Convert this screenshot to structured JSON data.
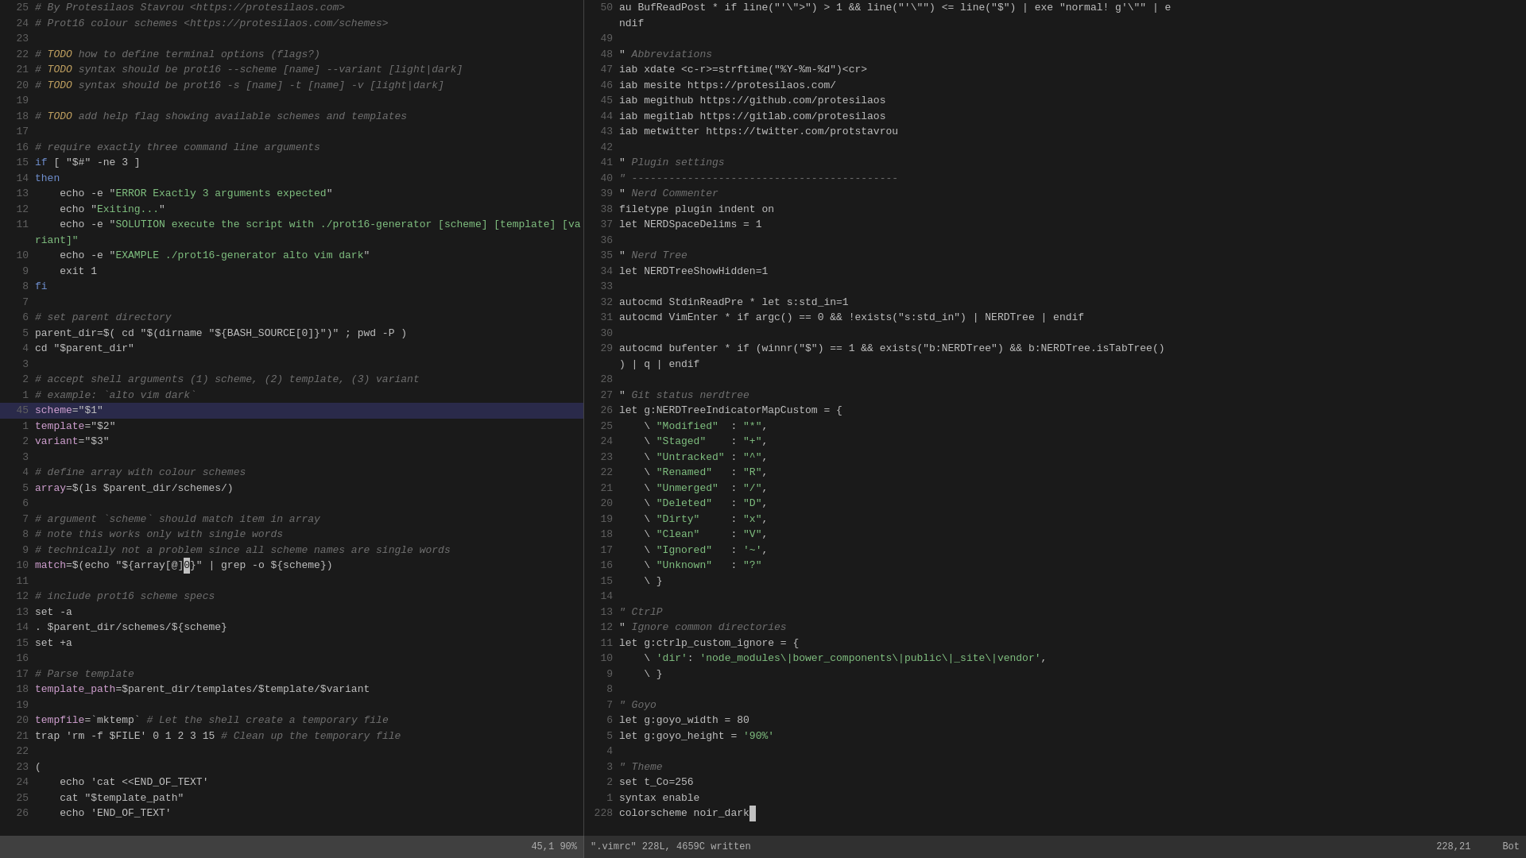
{
  "left_pane": {
    "lines": [
      {
        "num": "25",
        "content": "<comment># By Protesilaos Stavrou <https://protesilaos.com></comment>"
      },
      {
        "num": "24",
        "content": "<comment># Prot16 colour schemes <https://protesilaos.com/schemes></comment>"
      },
      {
        "num": "23",
        "content": ""
      },
      {
        "num": "22",
        "content": "<comment># <todo>TODO</todo> how to define terminal options (flags?)</comment>"
      },
      {
        "num": "21",
        "content": "<comment># <todo>TODO</todo> syntax should be prot16 --scheme [name] --variant [light|dark]</comment>"
      },
      {
        "num": "20",
        "content": "<comment># <todo>TODO</todo> syntax should be prot16 -s [name] -t [name] -v [light|dark]</comment>"
      },
      {
        "num": "19",
        "content": ""
      },
      {
        "num": "18",
        "content": "<comment># <todo>TODO</todo> add help flag showing available schemes and templates</comment>"
      },
      {
        "num": "17",
        "content": ""
      },
      {
        "num": "16",
        "content": "<comment># require exactly three command line arguments</comment>"
      },
      {
        "num": "15",
        "content": "<kw>if</kw> [ \"$#\" -ne 3 ]"
      },
      {
        "num": "14",
        "content": "<kw>then</kw>"
      },
      {
        "num": "13",
        "content": "    echo -e \"<str>ERROR Exactly 3 arguments expected</str>\""
      },
      {
        "num": "12",
        "content": "    echo \"<str>Exiting...</str>\""
      },
      {
        "num": "11",
        "content": "    echo -e \"<str>SOLUTION execute the script with ./prot16-generator [scheme] [template] [va</str>"
      },
      {
        "num": "",
        "content": "<str>riant]\"</str>"
      },
      {
        "num": "10",
        "content": "    echo -e \"<str>EXAMPLE ./prot16-generator alto vim dark</str>\""
      },
      {
        "num": "9",
        "content": "    exit 1"
      },
      {
        "num": "8",
        "content": "<kw>fi</kw>"
      },
      {
        "num": "7",
        "content": ""
      },
      {
        "num": "6",
        "content": "<comment># set parent directory</comment>"
      },
      {
        "num": "5",
        "content": "parent_dir=$( cd \"$(dirname \"${BASH_SOURCE[0]}\")\" ; pwd -P )"
      },
      {
        "num": "4",
        "content": "cd \"$parent_dir\""
      },
      {
        "num": "3",
        "content": ""
      },
      {
        "num": "2",
        "content": "<comment># accept shell arguments (1) scheme, (2) template, (3) variant</comment>"
      },
      {
        "num": "1",
        "content": "<comment># example: `alto vim dark`</comment>"
      },
      {
        "num": "45",
        "highlight": true,
        "content": "<var>scheme</var>=\"$1\""
      },
      {
        "num": "1",
        "content": "<var>template</var>=\"$2\""
      },
      {
        "num": "2",
        "content": "<var>variant</var>=\"$3\""
      },
      {
        "num": "3",
        "content": ""
      },
      {
        "num": "4",
        "content": "<comment># define array with colour schemes</comment>"
      },
      {
        "num": "5",
        "content": "<var>array</var>=$(ls $parent_dir/schemes/)"
      },
      {
        "num": "6",
        "content": ""
      },
      {
        "num": "7",
        "content": "<comment># argument `scheme` should match item in array</comment>"
      },
      {
        "num": "8",
        "content": "<comment># note this works only with single words</comment>"
      },
      {
        "num": "9",
        "content": "<comment># technically not a problem since all scheme names are single words</comment>"
      },
      {
        "num": "10",
        "content": "<var>match</var>=$(echo \"${array[@]<cursor>0</cursor>}\" | grep -o ${scheme})"
      },
      {
        "num": "11",
        "content": ""
      },
      {
        "num": "12",
        "content": "<comment># include prot16 scheme specs</comment>"
      },
      {
        "num": "13",
        "content": "set -a"
      },
      {
        "num": "14",
        "content": ". $parent_dir/schemes/${scheme}"
      },
      {
        "num": "15",
        "content": "set +a"
      },
      {
        "num": "16",
        "content": ""
      },
      {
        "num": "17",
        "content": "<comment># Parse template</comment>"
      },
      {
        "num": "18",
        "content": "<var>template_path</var>=$parent_dir/templates/$template/$variant"
      },
      {
        "num": "19",
        "content": ""
      },
      {
        "num": "20",
        "content": "<var>tempfile</var>=`mktemp` <comment># Let the shell create a temporary file</comment>"
      },
      {
        "num": "21",
        "content": "trap 'rm -f $FILE' 0 1 2 3 15 <comment># Clean up the temporary file</comment>"
      },
      {
        "num": "22",
        "content": ""
      },
      {
        "num": "23",
        "content": "("
      },
      {
        "num": "24",
        "content": "    echo 'cat <<END_OF_TEXT'"
      },
      {
        "num": "25",
        "content": "    cat \"$template_path\""
      },
      {
        "num": "26",
        "content": "    echo 'END_OF_TEXT'"
      }
    ],
    "status": "45,1          90%"
  },
  "right_pane": {
    "lines": [
      {
        "num": "50",
        "content": "au BufReadPost * if line(\"'\\\">\") > 1 && line(\"'\\\"\") <= line(\"$\") | exe \"normal! g'\\\"\" | e"
      },
      {
        "num": "",
        "content": "ndif"
      },
      {
        "num": "49",
        "content": ""
      },
      {
        "num": "48",
        "content": "\" <italic>Abbreviations</italic>"
      },
      {
        "num": "47",
        "content": "iab xdate <c-r>=strftime(\"%Y-%m-%d\")<cr>"
      },
      {
        "num": "46",
        "content": "iab mesite https://protesilaos.com/"
      },
      {
        "num": "45",
        "content": "iab megithub https://github.com/protesilaos"
      },
      {
        "num": "44",
        "content": "iab megitlab https://gitlab.com/protesilaos"
      },
      {
        "num": "43",
        "content": "iab metwitter https://twitter.com/protstavrou"
      },
      {
        "num": "42",
        "content": ""
      },
      {
        "num": "41",
        "content": "\" <italic>Plugin settings</italic>"
      },
      {
        "num": "40",
        "content": "\" -------------------------------------------"
      },
      {
        "num": "39",
        "content": "\" <italic>Nerd Commenter</italic>"
      },
      {
        "num": "38",
        "content": "filetype plugin indent on"
      },
      {
        "num": "37",
        "content": "let NERDSpaceDelims = 1"
      },
      {
        "num": "36",
        "content": ""
      },
      {
        "num": "35",
        "content": "\" <italic>Nerd Tree</italic>"
      },
      {
        "num": "34",
        "content": "let NERDTreeShowHidden=1"
      },
      {
        "num": "33",
        "content": ""
      },
      {
        "num": "32",
        "content": "autocmd StdinReadPre * let s:std_in=1"
      },
      {
        "num": "31",
        "content": "autocmd VimEnter * if argc() == 0 && !exists(\"s:std_in\") | NERDTree | endif"
      },
      {
        "num": "30",
        "content": ""
      },
      {
        "num": "29",
        "content": "autocmd bufenter * if (winnr(\"$\") == 1 && exists(\"b:NERDTree\") && b:NERDTree.isTabTree()"
      },
      {
        "num": "",
        "content": ") | q | endif"
      },
      {
        "num": "28",
        "content": ""
      },
      {
        "num": "27",
        "content": "\" <italic>Git status nerdtree</italic>"
      },
      {
        "num": "26",
        "content": "let g:NERDTreeIndicatorMapCustom = {"
      },
      {
        "num": "25",
        "content": "    \\ \"Modified\"  : \"*\","
      },
      {
        "num": "24",
        "content": "    \\ \"Staged\"    : \"+\","
      },
      {
        "num": "23",
        "content": "    \\ \"Untracked\" : \"^\","
      },
      {
        "num": "22",
        "content": "    \\ \"Renamed\"   : \"R\","
      },
      {
        "num": "21",
        "content": "    \\ \"Unmerged\"  : \"/\","
      },
      {
        "num": "20",
        "content": "    \\ \"Deleted\"   : \"D\","
      },
      {
        "num": "19",
        "content": "    \\ \"Dirty\"     : \"x\","
      },
      {
        "num": "18",
        "content": "    \\ \"Clean\"     : \"V\","
      },
      {
        "num": "17",
        "content": "    \\ \"Ignored\"   : '~',"
      },
      {
        "num": "16",
        "content": "    \\ \"Unknown\"   : \"?\""
      },
      {
        "num": "15",
        "content": "    \\ }"
      },
      {
        "num": "14",
        "content": ""
      },
      {
        "num": "13",
        "content": "\" CtrlP"
      },
      {
        "num": "12",
        "content": "\" <italic>Ignore common directories</italic>"
      },
      {
        "num": "11",
        "content": "let g:ctrlp_custom_ignore = {"
      },
      {
        "num": "10",
        "content": "    \\ 'dir': 'node_modules\\|bower_components\\|public\\|_site\\|vendor',"
      },
      {
        "num": "9",
        "content": "    \\ }"
      },
      {
        "num": "8",
        "content": ""
      },
      {
        "num": "7",
        "content": "\" <italic>Goyo</italic>"
      },
      {
        "num": "6",
        "content": "let g:goyo_width = 80"
      },
      {
        "num": "5",
        "content": "let g:goyo_height = '90%'"
      },
      {
        "num": "4",
        "content": ""
      },
      {
        "num": "3",
        "content": "\" <italic>Theme</italic>"
      },
      {
        "num": "2",
        "content": "set t_Co=256"
      },
      {
        "num": "1",
        "content": "syntax enable"
      },
      {
        "num": "228",
        "content": "colorscheme noir_dark<cursor_end>"
      }
    ],
    "status_file": "\".vimrc\" 228L, 4659C written",
    "status_pos": "228,21",
    "status_bot": "Bot"
  }
}
